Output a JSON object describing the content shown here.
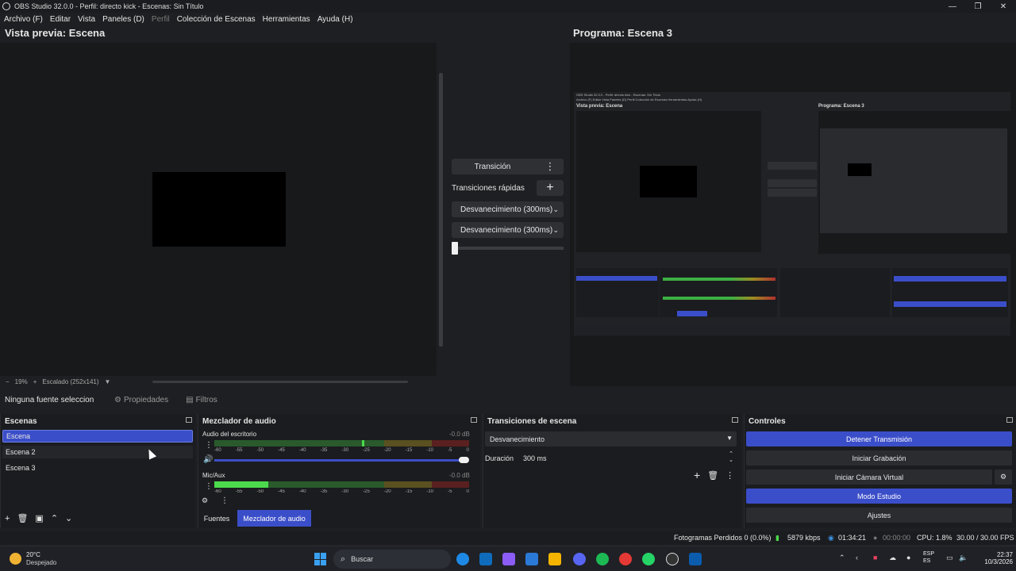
{
  "window": {
    "title": "OBS Studio 32.0.0 - Perfil: directo kick - Escenas: Sin Título",
    "controls": [
      "—",
      "❐",
      "✕"
    ]
  },
  "menu": [
    "Archivo (F)",
    "Editar",
    "Vista",
    "Paneles (D)",
    "Perfil",
    "Colección de Escenas",
    "Herramientas",
    "Ayuda (H)"
  ],
  "preview": {
    "label": "Vista previa: Escena",
    "zoom": "19%",
    "scale": "Escalado (252x141)"
  },
  "program": {
    "label": "Programa: Escena 3",
    "nested_title": "OBS Studio 32.0.0 - Perfil: directo kick - Escenas: Sin Título",
    "nested_menu": "Archivo (F)  Editar  Vista  Paneles (D)  Perfil  Colección de Escenas  Herramientas  Ayuda (H)",
    "nested_preview": "Vista previa: Escena",
    "nested_program": "Programa: Escena 3"
  },
  "transition_panel": {
    "transition_button": "Transición",
    "quick_transitions": "Transiciones rápidas",
    "quick1": "Desvanecimiento (300ms)",
    "quick2": "Desvanecimiento (300ms)"
  },
  "source_bar": {
    "no_selection": "Ninguna fuente seleccionada",
    "properties": "Propiedades",
    "filters": "Filtros"
  },
  "scenes": {
    "title": "Escenas",
    "items": [
      "Escena",
      "Escena 2",
      "Escena 3"
    ],
    "selected_index": 0
  },
  "mixer": {
    "title": "Mezclador de audio",
    "channels": [
      {
        "name": "Audio del escritorio",
        "db": "-0.0 dB"
      },
      {
        "name": "Mic/Aux",
        "db": "-0.0 dB"
      }
    ],
    "ticks": [
      "-60",
      "-55",
      "-50",
      "-45",
      "-40",
      "-35",
      "-30",
      "-25",
      "-20",
      "-15",
      "-10",
      "-5",
      "0"
    ],
    "tabs": [
      "Fuentes",
      "Mezclador de audio"
    ]
  },
  "scene_transitions": {
    "title": "Transiciones de escena",
    "selected": "Desvanecimiento",
    "duration_label": "Duración",
    "duration_value": "300 ms"
  },
  "controls": {
    "title": "Controles",
    "buttons": [
      "Detener Transmisión",
      "Iniciar Grabación",
      "Iniciar Cámara Virtual",
      "Modo Estudio",
      "Ajustes"
    ]
  },
  "status": {
    "dropped": "Fotogramas Perdidos 0 (0.0%)",
    "bitrate": "5879 kbps",
    "live_time": "01:34:21",
    "rec_time": "00:00:00",
    "cpu": "CPU: 1.8%",
    "fps": "30.00 / 30.00 FPS"
  },
  "taskbar": {
    "temp": "20°C",
    "condition": "Despejado",
    "search": "Buscar",
    "lang1": "ESP",
    "lang2": "ES",
    "time": "22:37",
    "date": "10/3/2026"
  },
  "colors": {
    "accent": "#3b4ec9",
    "background": "#1e1f22"
  }
}
